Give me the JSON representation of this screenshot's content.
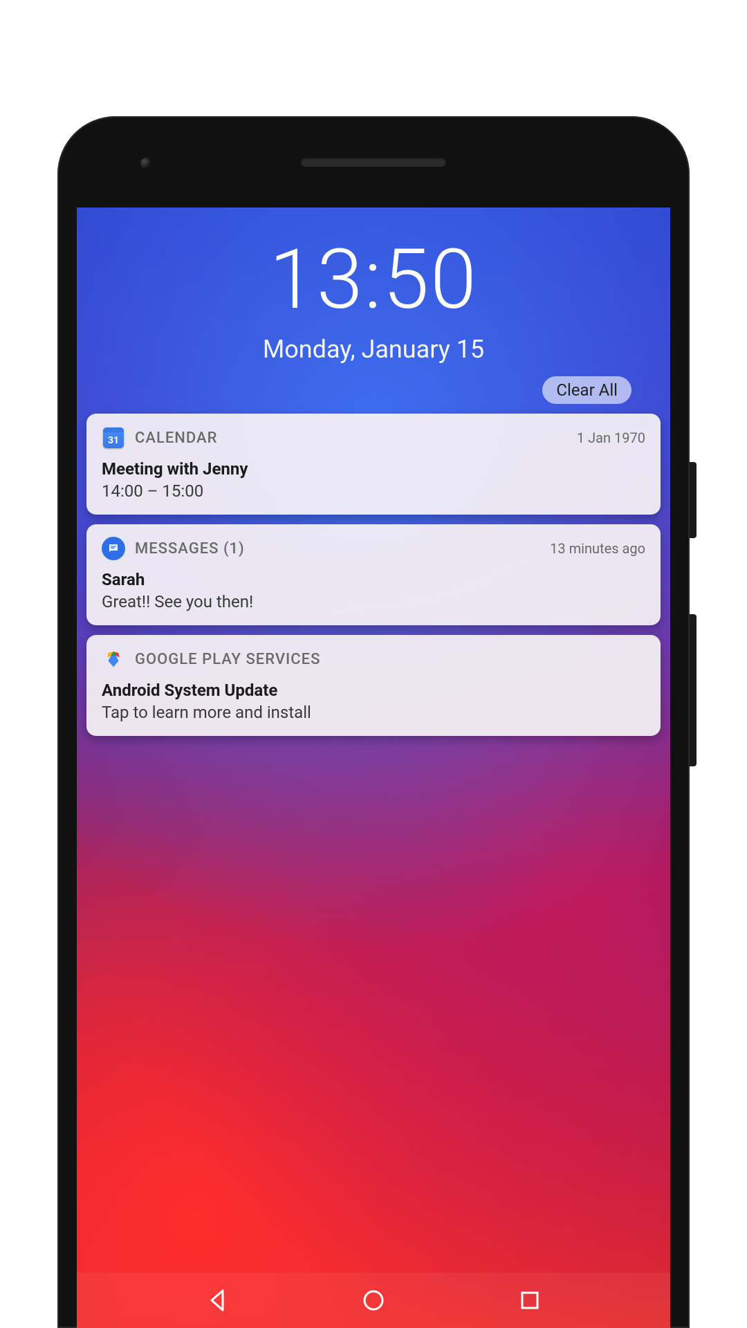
{
  "lockscreen": {
    "time": "13:50",
    "date": "Monday, January 15",
    "clear_all_label": "Clear All"
  },
  "notifications": [
    {
      "app": "CALENDAR",
      "icon": "calendar",
      "icon_text": "31",
      "timestamp": "1 Jan 1970",
      "title": "Meeting with Jenny",
      "body": "14:00 – 15:00"
    },
    {
      "app": "MESSAGES (1)",
      "icon": "messages",
      "timestamp": "13 minutes ago",
      "title": "Sarah",
      "body": "Great!! See you then!"
    },
    {
      "app": "GOOGLE PLAY SERVICES",
      "icon": "play",
      "timestamp": "",
      "title": "Android System Update",
      "body": "Tap to learn more and install"
    }
  ],
  "navbar": {
    "back": "Back",
    "home": "Home",
    "recent": "Recent apps"
  }
}
